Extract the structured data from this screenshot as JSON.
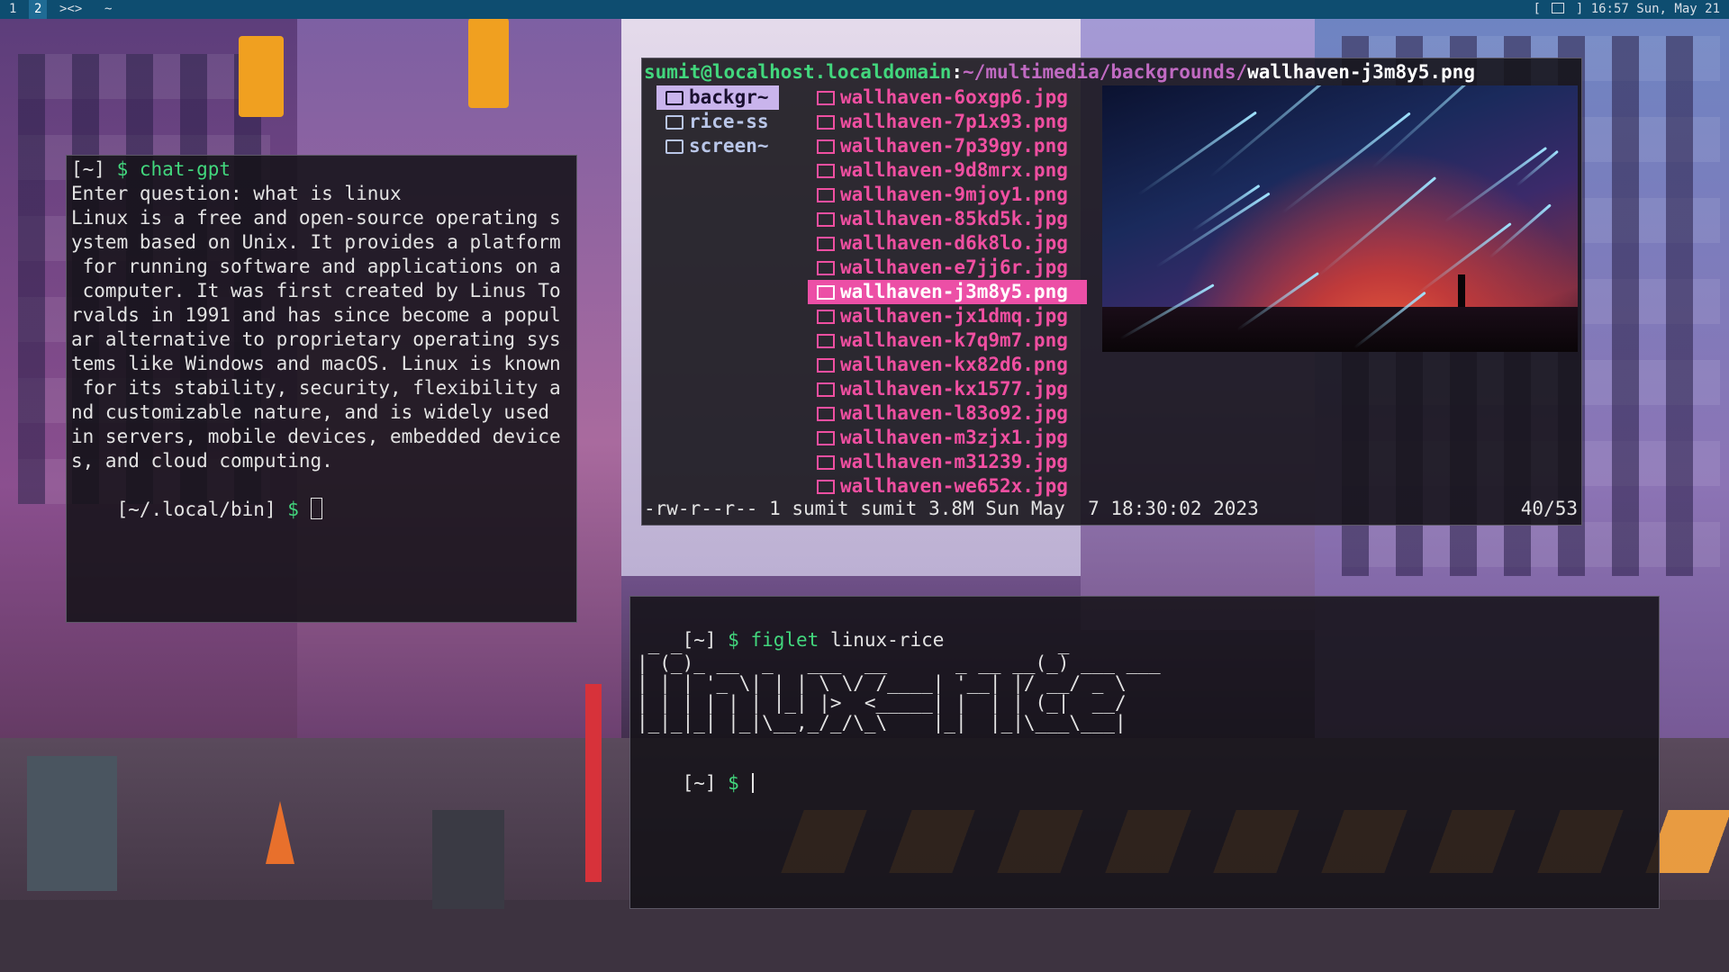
{
  "topbar": {
    "workspaces": [
      "1",
      "2"
    ],
    "layout": "><>",
    "title": "~",
    "tray_left": "[",
    "tray_right": "]",
    "clock": "16:57 Sun, May 21"
  },
  "chatgpt_terminal": {
    "lines": [
      {
        "pre": "[~] ",
        "sym": "$ ",
        "cmd": "chat-gpt"
      },
      {
        "text": "Enter question: what is linux"
      },
      {
        "text": "Linux is a free and open-source operating s"
      },
      {
        "text": "ystem based on Unix. It provides a platform"
      },
      {
        "text": " for running software and applications on a"
      },
      {
        "text": " computer. It was first created by Linus To"
      },
      {
        "text": "rvalds in 1991 and has since become a popul"
      },
      {
        "text": "ar alternative to proprietary operating sys"
      },
      {
        "text": "tems like Windows and macOS. Linux is known"
      },
      {
        "text": " for its stability, security, flexibility a"
      },
      {
        "text": "nd customizable nature, and is widely used"
      },
      {
        "text": "in servers, mobile devices, embedded device"
      },
      {
        "text": "s, and cloud computing."
      }
    ],
    "final_prompt": "[~/.local/bin] ",
    "final_symbol": "$ "
  },
  "file_manager": {
    "path_user": "sumit@localhost.localdomain",
    "path_sep": ":",
    "path_dir": "~/multimedia/backgrounds/",
    "path_file": "wallhaven-j3m8y5.png",
    "dirs": [
      {
        "name": "backgr~",
        "selected": true
      },
      {
        "name": "rice-ss",
        "selected": false
      },
      {
        "name": "screen~",
        "selected": false
      }
    ],
    "files": [
      {
        "name": "wallhaven-6oxgp6.jpg",
        "selected": false
      },
      {
        "name": "wallhaven-7p1x93.png",
        "selected": false
      },
      {
        "name": "wallhaven-7p39gy.png",
        "selected": false
      },
      {
        "name": "wallhaven-9d8mrx.png",
        "selected": false
      },
      {
        "name": "wallhaven-9mjoy1.png",
        "selected": false
      },
      {
        "name": "wallhaven-85kd5k.jpg",
        "selected": false
      },
      {
        "name": "wallhaven-d6k8lo.jpg",
        "selected": false
      },
      {
        "name": "wallhaven-e7jj6r.jpg",
        "selected": false
      },
      {
        "name": "wallhaven-j3m8y5.png",
        "selected": true
      },
      {
        "name": "wallhaven-jx1dmq.jpg",
        "selected": false
      },
      {
        "name": "wallhaven-k7q9m7.png",
        "selected": false
      },
      {
        "name": "wallhaven-kx82d6.png",
        "selected": false
      },
      {
        "name": "wallhaven-kx1577.jpg",
        "selected": false
      },
      {
        "name": "wallhaven-l83o92.jpg",
        "selected": false
      },
      {
        "name": "wallhaven-m3zjx1.jpg",
        "selected": false
      },
      {
        "name": "wallhaven-m31239.jpg",
        "selected": false
      },
      {
        "name": "wallhaven-we652x.jpg",
        "selected": false
      }
    ],
    "status": "-rw-r--r-- 1 sumit sumit 3.8M Sun May  7 18:30:02 2023",
    "count": "40/53"
  },
  "figlet_terminal": {
    "prompt": "[~] ",
    "symbol": "$ ",
    "command": "figlet",
    "argument": " linux-rice",
    "figlet_art": " _ _                                 _\n| (_)_ __  _   ___  __      _ __ __(_) ___ ___\n| | | '_ \\| | | \\ \\/ /____| '__| |/ __/ _ \\\n| | | | | | |_| |>  <_____| |  | | (_|  __/\n|_|_|_| |_|\\__,_/_/\\_\\    |_|  |_|\\___\\___|",
    "final_prompt": "[~] ",
    "final_symbol": "$ "
  },
  "colors": {
    "topbar": "#0e4d70",
    "prompt_green": "#42d77d",
    "file_pink": "#f04fa1",
    "dir_selected": "#c9b4ec"
  }
}
